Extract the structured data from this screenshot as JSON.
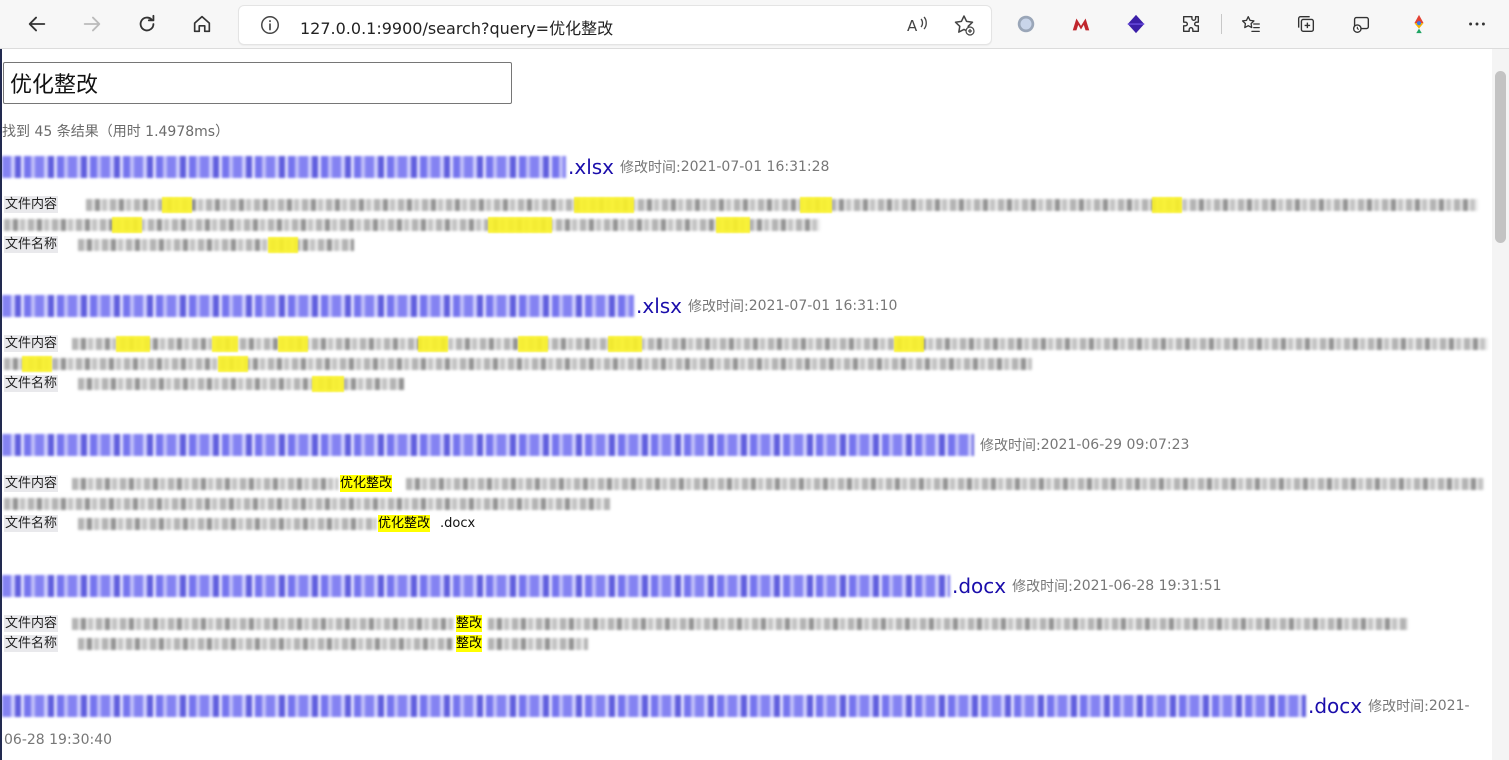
{
  "browser": {
    "url": "127.0.0.1:9900/search?query=优化整改",
    "colors": {
      "chrome_bg": "#f7f7f7",
      "accent": "#1a0dab"
    }
  },
  "search": {
    "value": "优化整改",
    "stats": "找到 45 条结果（用时 1.4978ms）"
  },
  "labels": {
    "mtime": "修改时间:",
    "content": "文件内容",
    "filename": "文件名称"
  },
  "results": [
    {
      "title_ext": ".xlsx",
      "mtime": "2021-07-01 16:31:28",
      "content_highlights": [],
      "filename_text": ""
    },
    {
      "title_ext": ".xlsx",
      "mtime": "2021-07-01 16:31:10",
      "content_highlights": [],
      "filename_text": ""
    },
    {
      "title_ext": "",
      "mtime": "2021-06-29 09:07:23",
      "content_highlight": "优化整改",
      "filename_highlight": "优化整改",
      "filename_suffix": ".docx"
    },
    {
      "title_ext": ".docx",
      "mtime": "2021-06-28 19:31:51",
      "content_highlight": "整改",
      "filename_highlight": "整改"
    },
    {
      "title_ext": ".docx",
      "mtime_part1": "2021-",
      "mtime_part2": "06-28 19:30:40"
    }
  ]
}
